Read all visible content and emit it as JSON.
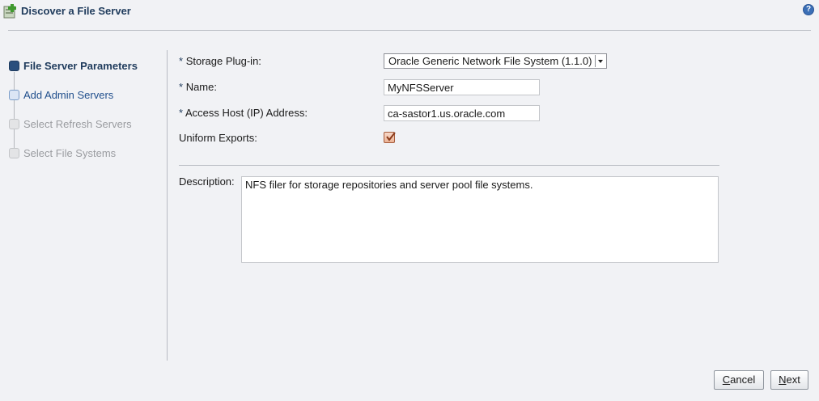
{
  "dialog": {
    "title": "Discover a File Server",
    "help_glyph": "?"
  },
  "train": {
    "steps": [
      {
        "label": "File Server Parameters",
        "state": "active"
      },
      {
        "label": "Add Admin Servers",
        "state": "enabled"
      },
      {
        "label": "Select Refresh Servers",
        "state": "disabled"
      },
      {
        "label": "Select File Systems",
        "state": "disabled"
      }
    ]
  },
  "form": {
    "required_marker": "*",
    "storage_plugin": {
      "label": "Storage Plug-in:",
      "value": "Oracle Generic Network File System (1.1.0)"
    },
    "name": {
      "label": "Name:",
      "value": "MyNFSServer"
    },
    "access_host": {
      "label": "Access Host (IP) Address:",
      "value": "ca-sastor1.us.oracle.com"
    },
    "uniform_exports": {
      "label": "Uniform Exports:",
      "checked": true
    },
    "description": {
      "label": "Description:",
      "value": "NFS filer for storage repositories and server pool file systems."
    }
  },
  "buttons": {
    "cancel": {
      "underlined": "C",
      "rest": "ancel"
    },
    "next": {
      "underlined": "N",
      "rest": "ext"
    }
  },
  "icons": {
    "header": "add-file-server-icon",
    "help": "help-icon",
    "check": "checkmark-icon"
  },
  "colors": {
    "accent": "#1f3b5c",
    "active_step": "#2a4f7d",
    "checkbox": "#ecb396"
  }
}
